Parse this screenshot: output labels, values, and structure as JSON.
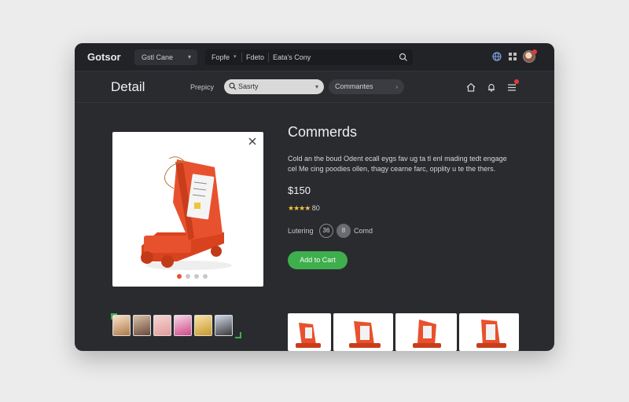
{
  "window": {
    "brand": "Gotsor",
    "category_select": {
      "value": "Gstl Cane"
    },
    "top_search": {
      "segment1": "Fopfe",
      "segment2": "Fdeto",
      "segment3": "Eata's Cony"
    },
    "icons": [
      "globe-icon",
      "grid-icon",
      "search-icon",
      "avatar"
    ]
  },
  "subbar": {
    "title": "Detail",
    "label": "Prepicy",
    "search_value": "Sasrty",
    "comments_button": "Commantes",
    "icons": [
      "home-icon",
      "bell-icon",
      "menu-icon"
    ]
  },
  "product": {
    "title": "Commerds",
    "description_line1": "Cold an the boud Odent ecall eygs fav ug ta tl enl mading tedt engage",
    "description_line2": "cel Me cing poodies ollen, thagy cearne farc, opplity u te the thers.",
    "price": "$150",
    "stars": "★★★★",
    "rating_count": "80",
    "quantity_label": "Lutering",
    "quantity_value": "36",
    "quantity_unit_value": "8",
    "quantity_unit_label": "Comd",
    "add_to_cart": "Add to Cart",
    "image_dots": 4,
    "active_dot": 0
  },
  "colors": {
    "accent_green": "#3fae4d",
    "product_orange": "#e8512d",
    "star_yellow": "#f3c33c",
    "notification_red": "#e33b3b"
  }
}
